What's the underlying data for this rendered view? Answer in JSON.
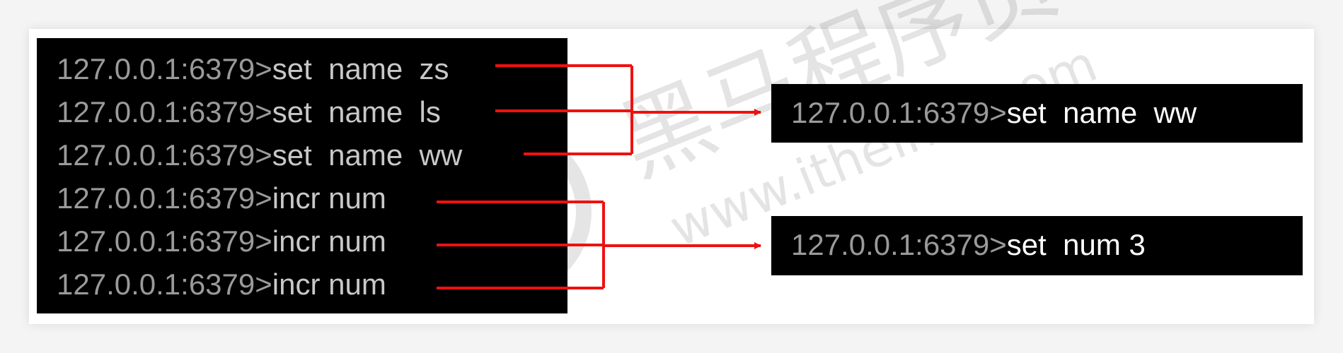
{
  "left_terminal": {
    "lines": [
      {
        "prompt": "127.0.0.1:6379>",
        "command": "set  name  zs"
      },
      {
        "prompt": "127.0.0.1:6379>",
        "command": "set  name  ls"
      },
      {
        "prompt": "127.0.0.1:6379>",
        "command": "set  name  ww"
      },
      {
        "prompt": "127.0.0.1:6379>",
        "command": "incr num"
      },
      {
        "prompt": "127.0.0.1:6379>",
        "command": "incr num"
      },
      {
        "prompt": "127.0.0.1:6379>",
        "command": "incr num"
      }
    ]
  },
  "result_top": {
    "prompt": "127.0.0.1:6379>",
    "command": "set  name  ww"
  },
  "result_bottom": {
    "prompt": "127.0.0.1:6379>",
    "command": "set  num 3"
  },
  "watermark": {
    "chinese": "黑马程序员",
    "url": "www.itheima.com"
  },
  "colors": {
    "arrow": "#ee1111",
    "terminal_bg": "#000000",
    "prompt": "#9a9a9a",
    "command_result": "#ffffff"
  }
}
